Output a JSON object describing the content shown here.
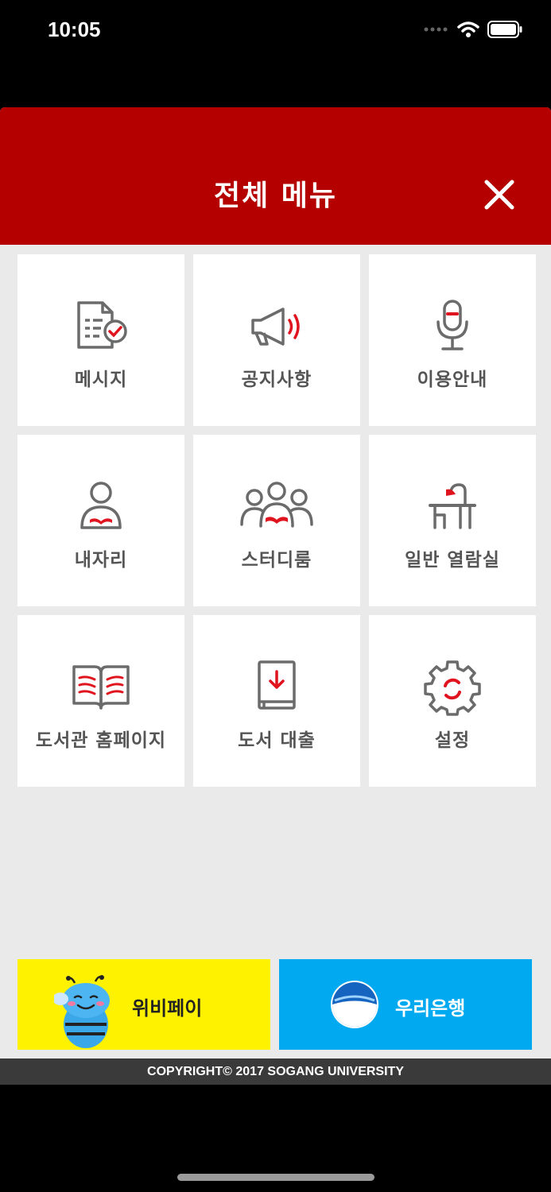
{
  "status_bar": {
    "time": "10:05"
  },
  "header": {
    "title": "전체 메뉴"
  },
  "menu": {
    "items": [
      {
        "label": "메시지",
        "icon": "message-document-icon"
      },
      {
        "label": "공지사항",
        "icon": "megaphone-icon"
      },
      {
        "label": "이용안내",
        "icon": "microphone-icon"
      },
      {
        "label": "내자리",
        "icon": "my-seat-person-icon"
      },
      {
        "label": "스터디룸",
        "icon": "study-room-group-icon"
      },
      {
        "label": "일반 열람실",
        "icon": "reading-room-desk-lamp-icon"
      },
      {
        "label": "도서관 홈페이지",
        "icon": "open-book-icon"
      },
      {
        "label": "도서 대출",
        "icon": "book-download-icon"
      },
      {
        "label": "설정",
        "icon": "gear-icon"
      }
    ]
  },
  "banners": {
    "wibee": {
      "label": "위비페이",
      "icon": "wibee-bee-mascot-icon"
    },
    "woori": {
      "label": "우리은행",
      "icon": "woori-bank-logo-icon"
    }
  },
  "footer": {
    "copyright": "COPYRIGHT© 2017 SOGANG UNIVERSITY"
  },
  "colors": {
    "header": "#b50000",
    "accent": "#e0141e",
    "icon_gray": "#6b6b6b",
    "wibee": "#fff200",
    "woori": "#00a9f0"
  }
}
